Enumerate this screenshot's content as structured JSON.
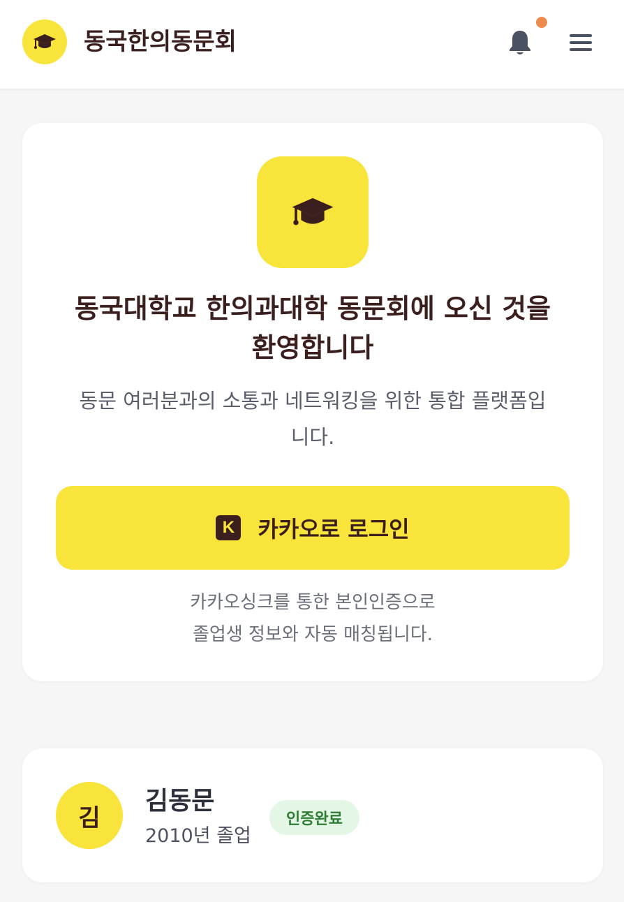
{
  "header": {
    "app_title": "동국한의동문회",
    "logo_icon": "graduation-cap-icon",
    "bell_icon": "bell-icon",
    "menu_icon": "hamburger-menu-icon"
  },
  "welcome": {
    "hero_icon": "graduation-cap-icon",
    "title_line1": "동국대학교 한의과대학 동문회에 오신 것을",
    "title_line2": "환영합니다",
    "subtitle_line1": "동문 여러분과의 소통과 네트워킹을 위한 통합 플랫폼입",
    "subtitle_line2": "니다.",
    "login_button_label": "카카오로 로그인",
    "kakao_icon_letter": "K",
    "note_line1": "카카오싱크를 통한 본인인증으로",
    "note_line2": "졸업생 정보와 자동 매칭됩니다."
  },
  "profile": {
    "avatar_text": "김",
    "name": "김동문",
    "graduation": "2010년 졸업",
    "badge": "인증완료"
  },
  "colors": {
    "brand_yellow": "#f9e43b",
    "brand_brown": "#3b1f1f",
    "notification_dot": "#ef8a4e",
    "badge_bg": "#e4f7e6",
    "badge_text": "#2e7d32"
  }
}
